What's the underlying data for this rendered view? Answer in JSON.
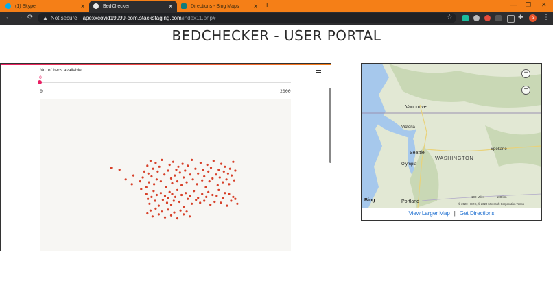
{
  "browser": {
    "tabs": [
      {
        "title": "(1) Skype",
        "icon_color": "#00aff0"
      },
      {
        "title": "BedChecker",
        "icon_color": "#e8e8e8"
      },
      {
        "title": "Directions - Bing Maps",
        "icon_color": "#0f7c7c"
      }
    ],
    "new_tab_icon": "+",
    "address": {
      "security_label": "Not secure",
      "domain": "apexxcovid19999-com.stackstaging.com",
      "path": "/index11.php#"
    },
    "profile_initial": "a"
  },
  "page": {
    "title": "BEDCHECKER - USER PORTAL"
  },
  "chart": {
    "slider_label": "No. of beds available",
    "slider_value": "0",
    "slider_min": "0",
    "slider_max": "2000",
    "dot_color": "#d7412a"
  },
  "chart_data": {
    "type": "scatter",
    "x": [
      32,
      48,
      60,
      72,
      75,
      88,
      90,
      93,
      96,
      100,
      102,
      104,
      105,
      108,
      110,
      113,
      115,
      118,
      120,
      122,
      125,
      128,
      130,
      135,
      138,
      142,
      145,
      148,
      150,
      152,
      155,
      158,
      160,
      162,
      165,
      168,
      170,
      172,
      175,
      178,
      180,
      185,
      188,
      190,
      195,
      198,
      200,
      205,
      208,
      210,
      212,
      215,
      218,
      220,
      222,
      225,
      228,
      230,
      235,
      238,
      240,
      242,
      245,
      248,
      250,
      252,
      255,
      258,
      260,
      262,
      265,
      268,
      270,
      272,
      100,
      103,
      106,
      110,
      114,
      117,
      120,
      124,
      128,
      132,
      136,
      140,
      142,
      145,
      148,
      150,
      153,
      156,
      160,
      164,
      168,
      172,
      176,
      180,
      184,
      188,
      192,
      196,
      200,
      204,
      208,
      212,
      216,
      220,
      224,
      228,
      232,
      236,
      240,
      244,
      248,
      252,
      256,
      260,
      264,
      268,
      272,
      276,
      102,
      108,
      112,
      118,
      124,
      130,
      136,
      142,
      148,
      154,
      160,
      166,
      172,
      178,
      184
    ],
    "y": [
      72,
      70,
      60,
      55,
      64,
      58,
      50,
      62,
      68,
      52,
      74,
      66,
      57,
      79,
      63,
      71,
      55,
      77,
      60,
      68,
      73,
      58,
      80,
      65,
      52,
      69,
      75,
      61,
      56,
      78,
      64,
      70,
      58,
      73,
      67,
      54,
      76,
      62,
      69,
      57,
      74,
      65,
      80,
      60,
      71,
      55,
      66,
      77,
      59,
      70,
      63,
      52,
      75,
      68,
      58,
      72,
      61,
      79,
      65,
      54,
      70,
      62,
      76,
      57,
      68,
      73,
      60,
      66,
      55,
      71,
      64,
      78,
      59,
      69,
      45,
      40,
      35,
      42,
      48,
      38,
      44,
      33,
      46,
      39,
      43,
      36,
      41,
      47,
      34,
      45,
      38,
      42,
      49,
      37,
      44,
      32,
      46,
      40,
      43,
      35,
      48,
      39,
      41,
      36,
      45,
      38,
      42,
      47,
      34,
      44,
      37,
      43,
      49,
      36,
      41,
      46,
      33,
      45,
      38,
      42,
      40,
      35,
      25,
      28,
      22,
      30,
      24,
      27,
      21,
      29,
      23,
      26,
      20,
      28,
      24,
      27,
      22
    ],
    "xlim": [
      0,
      300
    ],
    "ylim": [
      0,
      100
    ],
    "grid": false
  },
  "map": {
    "labels": {
      "vancouver": "Vancouver",
      "victoria": "Victoria",
      "seattle": "Seattle",
      "olympia": "Olympia",
      "washington": "WASHINGTON",
      "spokane": "Spokane",
      "portland": "Portland"
    },
    "zoom_in": "+",
    "zoom_out": "−",
    "bing_label": "Bing",
    "scale_miles": "100 Miles",
    "scale_km": "100 km",
    "copyright": "© 2020 HERE, © 2020 Microsoft Corporation  Terms",
    "link_larger": "View Larger Map",
    "link_separator": "|",
    "link_directions": "Get Directions",
    "colors": {
      "water": "#a6c8ec",
      "land": "#e2e8d4",
      "forest": "#c9d8b5",
      "road": "#f0e6b0"
    }
  }
}
